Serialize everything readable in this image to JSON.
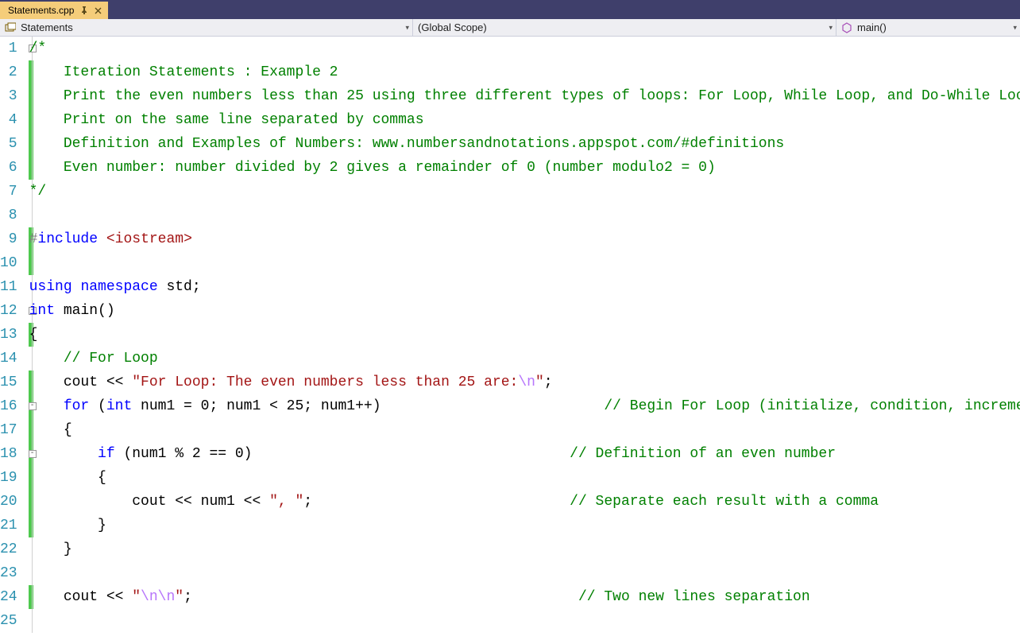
{
  "tab": {
    "title": "Statements.cpp"
  },
  "nav": {
    "class_selector": "Statements",
    "scope_selector": "(Global Scope)",
    "member_selector": "main()"
  },
  "lines": [
    {
      "n": 1,
      "changed": false,
      "outline": "box",
      "tokens": [
        [
          "c-comment",
          "/*"
        ]
      ]
    },
    {
      "n": 2,
      "changed": true,
      "tokens": [
        [
          "c-default",
          "    "
        ],
        [
          "c-comment",
          "Iteration Statements : Example 2"
        ]
      ]
    },
    {
      "n": 3,
      "changed": true,
      "tokens": [
        [
          "c-default",
          "    "
        ],
        [
          "c-comment",
          "Print the even numbers less than 25 using three different types of loops: For Loop, While Loop, and Do-While Loop"
        ]
      ]
    },
    {
      "n": 4,
      "changed": true,
      "tokens": [
        [
          "c-default",
          "    "
        ],
        [
          "c-comment",
          "Print on the same line separated by commas"
        ]
      ]
    },
    {
      "n": 5,
      "changed": true,
      "tokens": [
        [
          "c-default",
          "    "
        ],
        [
          "c-comment",
          "Definition and Examples of Numbers: www.numbersandnotations.appspot.com/#definitions"
        ]
      ]
    },
    {
      "n": 6,
      "changed": true,
      "tokens": [
        [
          "c-default",
          "    "
        ],
        [
          "c-comment",
          "Even number: number divided by 2 gives a remainder of 0 (number modulo2 = 0)"
        ]
      ]
    },
    {
      "n": 7,
      "changed": false,
      "tokens": [
        [
          "c-comment",
          "*/"
        ]
      ]
    },
    {
      "n": 8,
      "changed": false,
      "tokens": [
        [
          "c-default",
          ""
        ]
      ]
    },
    {
      "n": 9,
      "changed": true,
      "tokens": [
        [
          "c-pp",
          "#"
        ],
        [
          "c-ppkw",
          "include"
        ],
        [
          "c-default",
          " "
        ],
        [
          "c-angle",
          "<iostream>"
        ]
      ]
    },
    {
      "n": 10,
      "changed": true,
      "tokens": [
        [
          "c-default",
          ""
        ]
      ]
    },
    {
      "n": 11,
      "changed": false,
      "tokens": [
        [
          "c-keyword",
          "using"
        ],
        [
          "c-default",
          " "
        ],
        [
          "c-keyword",
          "namespace"
        ],
        [
          "c-default",
          " std;"
        ]
      ]
    },
    {
      "n": 12,
      "changed": false,
      "outline": "box",
      "tokens": [
        [
          "c-keyword",
          "int"
        ],
        [
          "c-default",
          " "
        ],
        [
          "c-func",
          "main"
        ],
        [
          "c-default",
          "()"
        ]
      ]
    },
    {
      "n": 13,
      "changed": true,
      "tokens": [
        [
          "c-default",
          "{"
        ]
      ]
    },
    {
      "n": 14,
      "changed": false,
      "tokens": [
        [
          "c-default",
          "    "
        ],
        [
          "c-comment",
          "// For Loop"
        ]
      ]
    },
    {
      "n": 15,
      "changed": true,
      "tokens": [
        [
          "c-default",
          "    cout "
        ],
        [
          "c-default",
          "<< "
        ],
        [
          "c-string",
          "\"For Loop: The even numbers less than 25 are:"
        ],
        [
          "c-esc",
          "\\n"
        ],
        [
          "c-string",
          "\""
        ],
        [
          "c-default",
          ";"
        ]
      ]
    },
    {
      "n": 16,
      "changed": true,
      "outline": "box",
      "tokens": [
        [
          "c-default",
          "    "
        ],
        [
          "c-keyword",
          "for"
        ],
        [
          "c-default",
          " ("
        ],
        [
          "c-keyword",
          "int"
        ],
        [
          "c-default",
          " num1 = 0; num1 < 25; num1++)                          "
        ],
        [
          "c-comment",
          "// Begin For Loop (initialize, condition, increment)"
        ]
      ]
    },
    {
      "n": 17,
      "changed": true,
      "tokens": [
        [
          "c-default",
          "    {"
        ]
      ]
    },
    {
      "n": 18,
      "changed": true,
      "outline": "box",
      "tokens": [
        [
          "c-default",
          "        "
        ],
        [
          "c-keyword",
          "if"
        ],
        [
          "c-default",
          " (num1 % 2 == 0)                                     "
        ],
        [
          "c-comment",
          "// Definition of an even number"
        ]
      ]
    },
    {
      "n": 19,
      "changed": true,
      "tokens": [
        [
          "c-default",
          "        {"
        ]
      ]
    },
    {
      "n": 20,
      "changed": true,
      "tokens": [
        [
          "c-default",
          "            cout << num1 << "
        ],
        [
          "c-string",
          "\", \""
        ],
        [
          "c-default",
          ";                              "
        ],
        [
          "c-comment",
          "// Separate each result with a comma"
        ]
      ]
    },
    {
      "n": 21,
      "changed": true,
      "tokens": [
        [
          "c-default",
          "        }"
        ]
      ]
    },
    {
      "n": 22,
      "changed": false,
      "tokens": [
        [
          "c-default",
          "    }"
        ]
      ]
    },
    {
      "n": 23,
      "changed": false,
      "tokens": [
        [
          "c-default",
          ""
        ]
      ]
    },
    {
      "n": 24,
      "changed": true,
      "tokens": [
        [
          "c-default",
          "    cout << "
        ],
        [
          "c-string",
          "\""
        ],
        [
          "c-esc",
          "\\n\\n"
        ],
        [
          "c-string",
          "\""
        ],
        [
          "c-default",
          ";                                             "
        ],
        [
          "c-comment",
          "// Two new lines separation"
        ]
      ]
    },
    {
      "n": 25,
      "changed": false,
      "tokens": [
        [
          "c-default",
          ""
        ]
      ]
    }
  ]
}
